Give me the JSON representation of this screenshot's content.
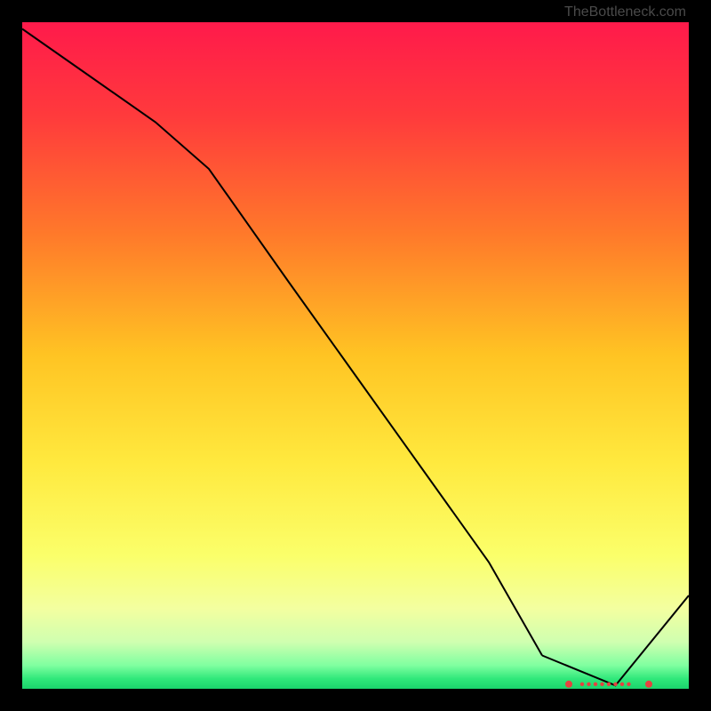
{
  "source_caption": "TheBottleneck.com",
  "chart_data": {
    "type": "line",
    "title": "",
    "xlabel": "",
    "ylabel": "",
    "xlim": [
      0,
      100
    ],
    "ylim": [
      0,
      100
    ],
    "x": [
      0,
      10,
      20,
      28,
      40,
      50,
      60,
      70,
      78,
      82,
      86,
      90,
      94,
      100
    ],
    "y": [
      99,
      92,
      85,
      78,
      61,
      47,
      33,
      19,
      5,
      "NaN",
      "NaN",
      "NaN",
      "NaN",
      14
    ],
    "valley_points": {
      "x": [
        82,
        84,
        85,
        86,
        87,
        88,
        89,
        90,
        91,
        94
      ],
      "y": [
        0.7,
        0.7,
        0.7,
        0.7,
        0.7,
        0.7,
        0.7,
        0.7,
        0.7,
        0.7
      ]
    },
    "gradient_stops": [
      {
        "offset": 0.0,
        "color": "#ff1a4b"
      },
      {
        "offset": 0.14,
        "color": "#ff3a3c"
      },
      {
        "offset": 0.32,
        "color": "#ff7a2a"
      },
      {
        "offset": 0.5,
        "color": "#ffc423"
      },
      {
        "offset": 0.66,
        "color": "#ffe93e"
      },
      {
        "offset": 0.8,
        "color": "#fbff6a"
      },
      {
        "offset": 0.88,
        "color": "#f3ffa0"
      },
      {
        "offset": 0.93,
        "color": "#cfffb0"
      },
      {
        "offset": 0.965,
        "color": "#7fffa0"
      },
      {
        "offset": 0.985,
        "color": "#30e87a"
      },
      {
        "offset": 1.0,
        "color": "#1ad46c"
      }
    ]
  }
}
